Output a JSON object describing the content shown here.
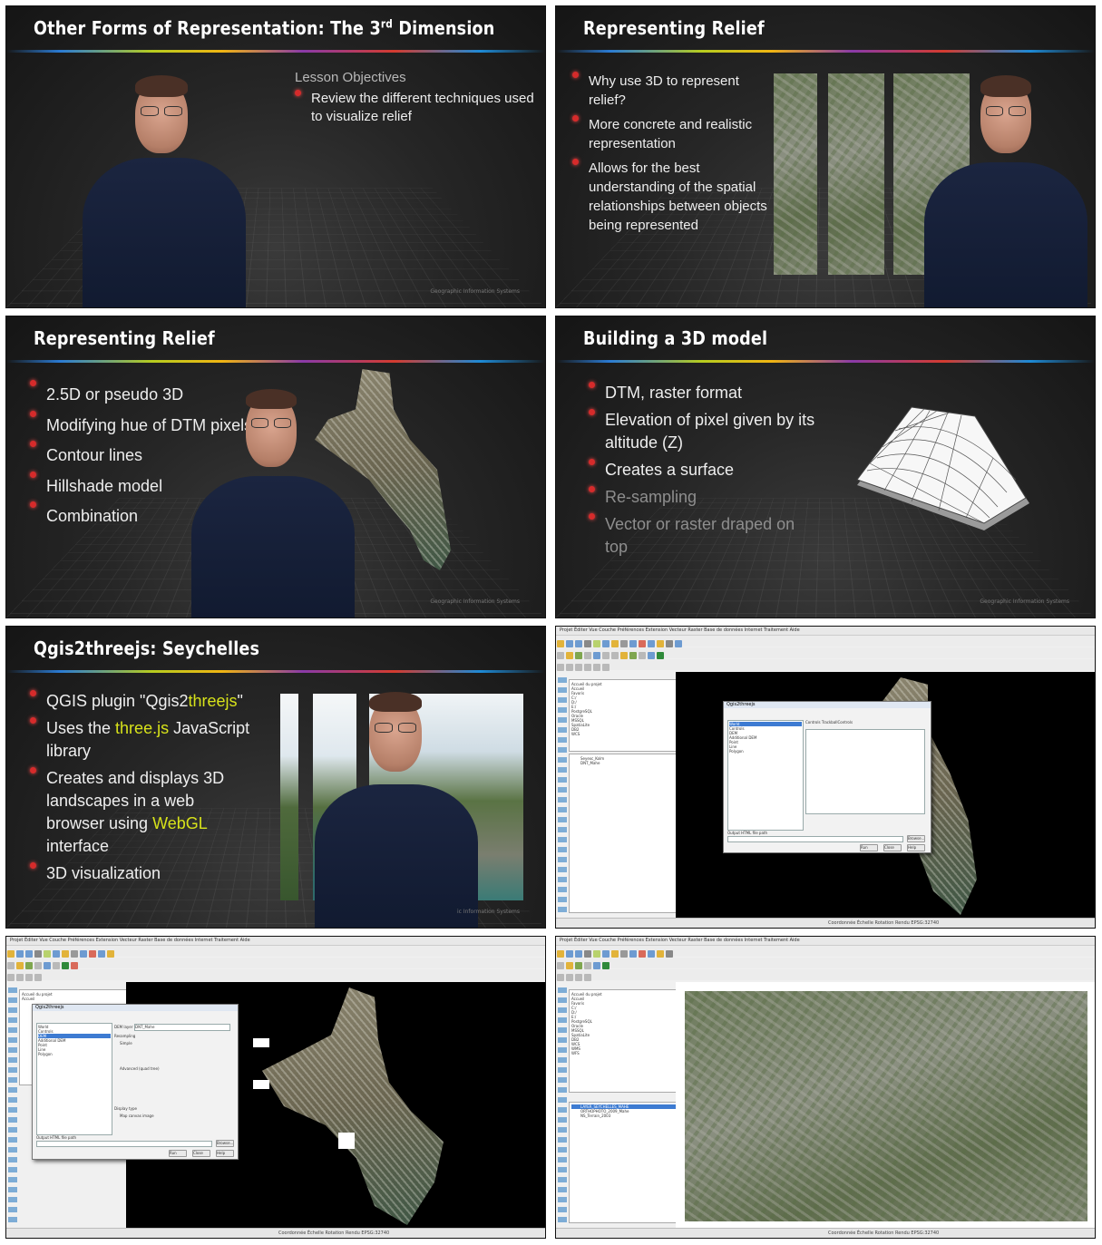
{
  "slide1": {
    "title_main": "Other Forms of Representation: The 3",
    "title_sup": "rd",
    "title_end": " Dimension",
    "objectives_heading": "Lesson Objectives",
    "bullets": [
      "Review the different techniques used to visualize relief"
    ],
    "footer": "Geographic Information Systems"
  },
  "slide2": {
    "title": "Representing Relief",
    "bullets": [
      "Why use 3D to represent relief?",
      "More concrete and realistic representation",
      "Allows for the best understanding of the spatial relationships between objects being represented"
    ]
  },
  "slide3": {
    "title": "Representing Relief",
    "bullets": [
      "2.5D or pseudo 3D",
      "Modifying hue of DTM pixels",
      "Contour lines",
      "Hillshade model",
      "Combination"
    ],
    "footer": "Geographic Information Systems"
  },
  "slide4": {
    "title": "Building a 3D model",
    "bullets": [
      "DTM, raster format",
      "Elevation of pixel given by its altitude (Z)",
      "Creates a surface"
    ],
    "dim_bullets": [
      "Re-sampling",
      "Vector or raster draped on top"
    ],
    "footer": "Geographic Information Systems"
  },
  "slide5": {
    "title": "Qgis2threejs: Seychelles",
    "b1_pre": "QGIS plugin \"Qgis2",
    "b1_hl": "threejs",
    "b1_post": "\"",
    "b2_pre": "Uses the ",
    "b2_hl": "three.js",
    "b2_post": " JavaScript library",
    "b3_pre": "Creates and displays 3D landscapes in a web browser using ",
    "b3_hl": "WebGL",
    "b3_post": " interface",
    "b4": "3D visualization",
    "footer": "ic Information Systems"
  },
  "qgis": {
    "menu": "Projet  Éditer  Vue  Couche  Préférences  Extension  Vecteur  Raster  Base de données  Internet  Traitement  Aide",
    "layers": [
      "Accueil du projet",
      "Accueil",
      "Favoris",
      "C:/",
      "D:/",
      "E:/",
      "PostgreSQL",
      "Oracle",
      "MSSQL",
      "SpatiaLite",
      "DB2",
      "WCS",
      "WMS",
      "WFS"
    ],
    "layer_panel": [
      "Seyexc_Kolm",
      "DNT_Mahe"
    ],
    "status": "Coordonnée  Échelle  Rotation  Rendu  EPSG:32740",
    "dialog_title": "Qgis2threejs",
    "dialog_tree": [
      "World",
      "Controls",
      "DEM",
      "Additional DEM",
      "Point",
      "Line",
      "Polygon"
    ],
    "dialog_right": "Controls   TrackballControls",
    "output_label": "Output HTML file path",
    "buttons": [
      "Run",
      "Close",
      "Help"
    ],
    "browse": "Browse...",
    "dem_layer_label": "DEM layer",
    "dem_layer_value": "DNT_Mahe",
    "resampling": "Resampling",
    "simple": "Simple",
    "advanced": "Advanced (quad tree)",
    "display_type": "Display type",
    "map_canvas_image": "Map canvas image",
    "layer4_sel": "LAYER_SEYCHELLES_MAHE",
    "layer4_b": "ORTHOPHOTO_2009_Mahe",
    "layer4_c": "NS_Terrain_2003"
  }
}
